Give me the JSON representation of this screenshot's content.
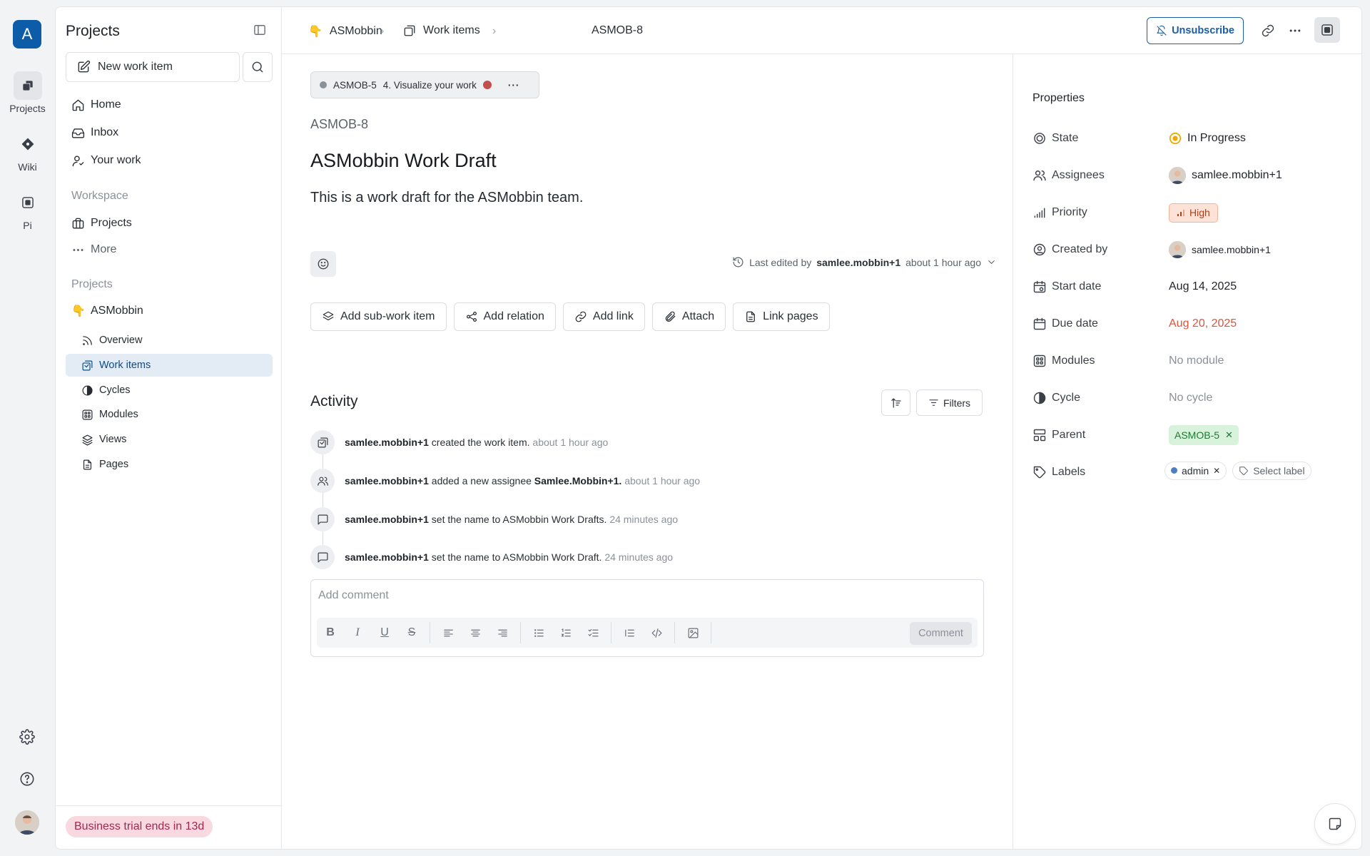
{
  "rail": {
    "workspace_initial": "A",
    "items": [
      {
        "label": "Projects",
        "icon": "projects-icon"
      },
      {
        "label": "Wiki",
        "icon": "wiki-icon"
      },
      {
        "label": "Pi",
        "icon": "pi-icon"
      }
    ]
  },
  "sidebar": {
    "title": "Projects",
    "new_item_label": "New work item",
    "nav": [
      {
        "label": "Home",
        "icon": "home-icon"
      },
      {
        "label": "Inbox",
        "icon": "inbox-icon"
      },
      {
        "label": "Your work",
        "icon": "user-icon"
      }
    ],
    "workspace_heading": "Workspace",
    "workspace_items": [
      {
        "label": "Projects",
        "icon": "briefcase-icon"
      },
      {
        "label": "More",
        "icon": "ellipsis-icon"
      }
    ],
    "projects_heading": "Projects",
    "project": {
      "emoji": "👇",
      "name": "ASMobbin"
    },
    "project_items": [
      {
        "label": "Overview"
      },
      {
        "label": "Work items"
      },
      {
        "label": "Cycles"
      },
      {
        "label": "Modules"
      },
      {
        "label": "Views"
      },
      {
        "label": "Pages"
      }
    ],
    "trial_text": "Business trial ends in 13d"
  },
  "header": {
    "breadcrumbs": [
      {
        "label": "ASMobbin",
        "emoji": "👇"
      },
      {
        "label": "Work items"
      },
      {
        "label": "ASMOB-8"
      }
    ],
    "unsubscribe_label": "Unsubscribe"
  },
  "issue": {
    "parent": {
      "id": "ASMOB-5",
      "title": "4. Visualize your work"
    },
    "id": "ASMOB-8",
    "title": "ASMobbin Work Draft",
    "description": "This is a work draft for the ASMobbin team.",
    "edited_prefix": "Last edited by",
    "edited_user": "samlee.mobbin+1",
    "edited_time": "about 1 hour ago",
    "actions": [
      "Add sub-work item",
      "Add relation",
      "Add link",
      "Attach",
      "Link pages"
    ]
  },
  "activity": {
    "title": "Activity",
    "filters_label": "Filters",
    "entries": [
      {
        "user": "samlee.mobbin+1",
        "text": "created the work item.",
        "time": "about 1 hour ago",
        "icon": "work-item-icon"
      },
      {
        "user": "samlee.mobbin+1",
        "text": "added a new assignee",
        "target": "Samlee.Mobbin+1.",
        "time": "about 1 hour ago",
        "icon": "users-icon"
      },
      {
        "user": "samlee.mobbin+1",
        "text": "set the name to ASMobbin Work Drafts.",
        "time": "24 minutes ago",
        "icon": "message-icon"
      },
      {
        "user": "samlee.mobbin+1",
        "text": "set the name to ASMobbin Work Draft.",
        "time": "24 minutes ago",
        "icon": "message-icon"
      }
    ],
    "comment_placeholder": "Add comment",
    "comment_button": "Comment"
  },
  "properties": {
    "title": "Properties",
    "state": {
      "label": "State",
      "value": "In Progress"
    },
    "assignees": {
      "label": "Assignees",
      "value": "samlee.mobbin+1"
    },
    "priority": {
      "label": "Priority",
      "value": "High"
    },
    "created_by": {
      "label": "Created by",
      "value": "samlee.mobbin+1"
    },
    "start_date": {
      "label": "Start date",
      "value": "Aug 14, 2025"
    },
    "due_date": {
      "label": "Due date",
      "value": "Aug 20, 2025"
    },
    "modules": {
      "label": "Modules",
      "value": "No module"
    },
    "cycle": {
      "label": "Cycle",
      "value": "No cycle"
    },
    "parent": {
      "label": "Parent",
      "value": "ASMOB-5"
    },
    "labels": {
      "label": "Labels",
      "value": "admin",
      "select_label": "Select label"
    }
  },
  "colors": {
    "accent": "#1b5ea6",
    "state_in_progress": "#f0a800",
    "due_date": "#e0533a",
    "trial_bg": "#f8d9e1"
  }
}
